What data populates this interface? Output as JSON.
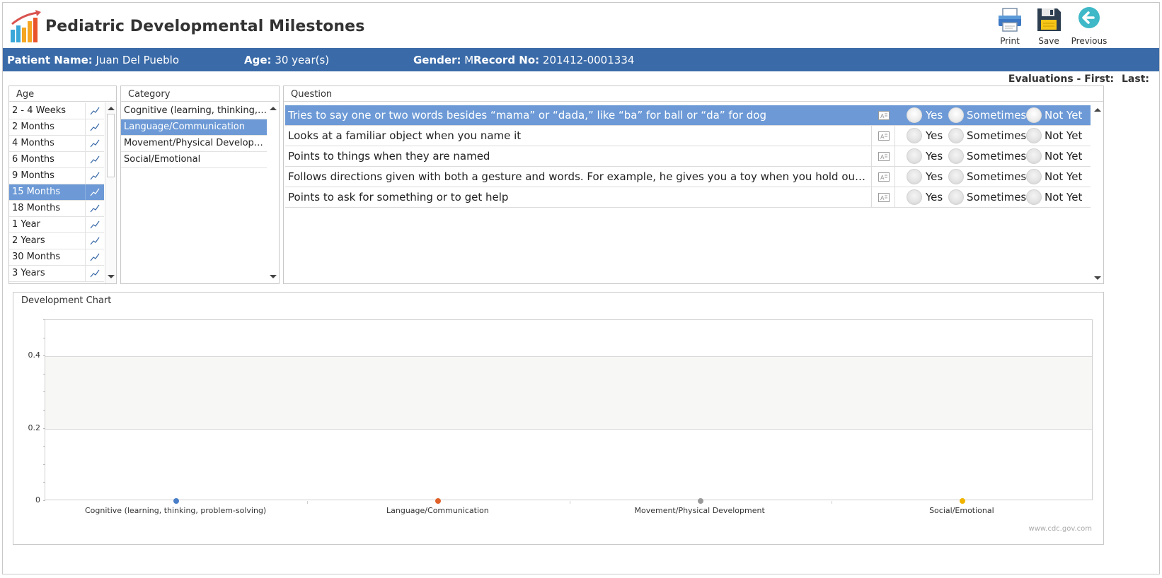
{
  "app": {
    "title": "Pediatric Developmental Milestones"
  },
  "toolbar": {
    "print_label": "Print",
    "save_label": "Save",
    "previous_label": "Previous"
  },
  "patient": {
    "name_label": "Patient Name:",
    "name": "Juan Del Pueblo",
    "age_label": "Age:",
    "age": "30 year(s)",
    "gender_label": "Gender:",
    "gender": "M",
    "record_label": "Record No:",
    "record": "201412-0001334"
  },
  "evaluations": {
    "label": "Evaluations - First:",
    "last_label": "Last:"
  },
  "age_panel": {
    "header": "Age",
    "selected_index": 5,
    "items": [
      "2 - 4 Weeks",
      "2 Months",
      "4 Months",
      "6 Months",
      "9 Months",
      "15 Months",
      "18 Months",
      "1 Year",
      "2 Years",
      "30 Months",
      "3 Years"
    ]
  },
  "category_panel": {
    "header": "Category",
    "selected_index": 1,
    "items": [
      "Cognitive (learning, thinking, pr...",
      "Language/Communication",
      "Movement/Physical Developme...",
      "Social/Emotional"
    ]
  },
  "question_panel": {
    "header": "Question",
    "selected_index": 0,
    "options": [
      "Yes",
      "Sometimes",
      "Not Yet"
    ],
    "items": [
      "Tries to say one or two words besides “mama” or “dada,” like “ba” for ball or “da” for dog",
      "Looks at a familiar object when you name it",
      "Points to things when they are named",
      "Follows directions given with both a gesture and words. For example, he gives you a toy when you hold out your hand a...",
      "Points to ask for something or to get help"
    ]
  },
  "chart": {
    "title": "Development Chart",
    "credit": "www.cdc.gov.com"
  },
  "chart_data": {
    "type": "scatter",
    "categories": [
      "Cognitive (learning, thinking, problem-solving)",
      "Language/Communication",
      "Movement/Physical Development",
      "Social/Emotional"
    ],
    "values": [
      0,
      0,
      0,
      0
    ],
    "colors": [
      "#4a7fc8",
      "#e0622a",
      "#9a9a9a",
      "#f0b400"
    ],
    "ylim": [
      0,
      0.5
    ],
    "yticks": [
      0,
      0.2,
      0.4
    ],
    "ytick_labels": [
      "0",
      "0.2",
      "0.4"
    ],
    "grid": true
  }
}
